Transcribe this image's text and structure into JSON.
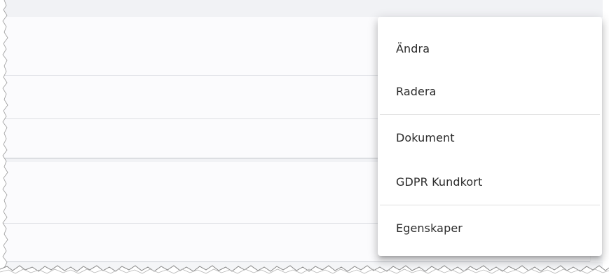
{
  "context_menu": {
    "items": [
      {
        "label": "Ändra"
      },
      {
        "label": "Radera"
      },
      {
        "label": "Dokument"
      },
      {
        "label": "GDPR Kundkort"
      },
      {
        "label": "Egenskaper"
      }
    ]
  },
  "colors": {
    "page_background": "#fafbfd",
    "band_background": "#f1f2f5",
    "row_divider": "#dfe1e6",
    "menu_background": "#ffffff",
    "menu_text": "#2b2b2b"
  }
}
